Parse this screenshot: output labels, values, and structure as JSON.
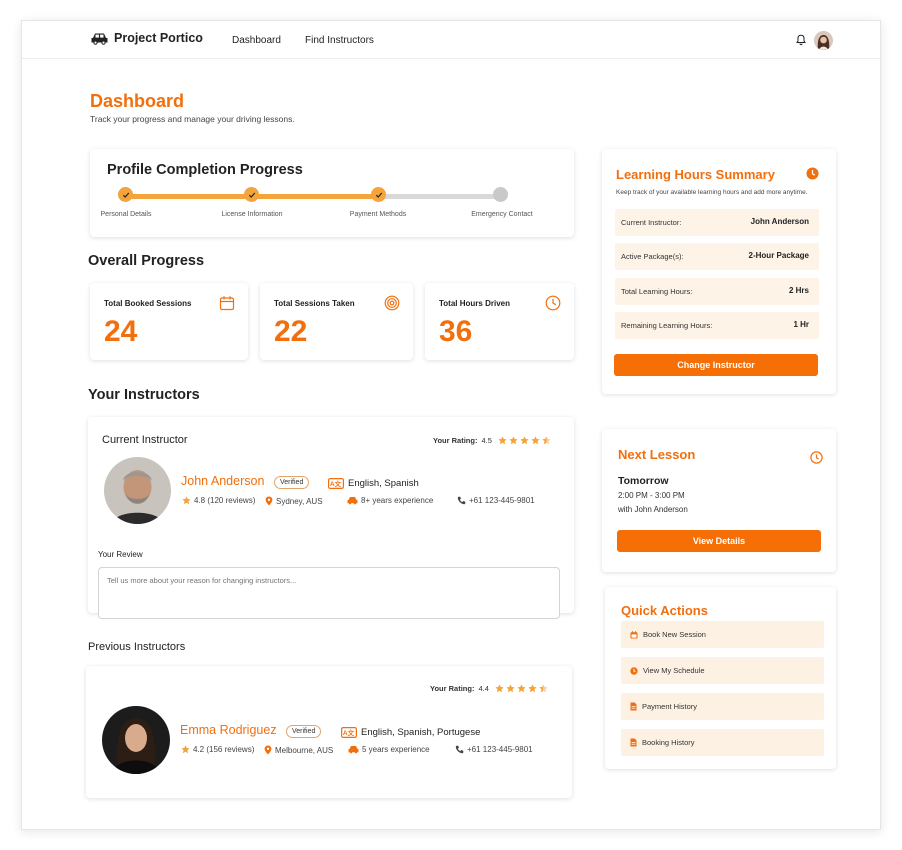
{
  "app": {
    "name": "Project Portico"
  },
  "nav": {
    "dashboard": "Dashboard",
    "find_instructors": "Find Instructors"
  },
  "page": {
    "title": "Dashboard",
    "subtitle": "Track your progress and manage your driving lessons."
  },
  "profile_progress": {
    "title": "Profile Completion Progress",
    "completed_steps": 3,
    "steps": [
      {
        "label": "Personal Details",
        "done": true
      },
      {
        "label": "License Information",
        "done": true
      },
      {
        "label": "Payment Methods",
        "done": true
      },
      {
        "label": "Emergency Contact",
        "done": false
      }
    ]
  },
  "overall": {
    "title": "Overall Progress",
    "stats": [
      {
        "label": "Total Booked Sessions",
        "value": "24",
        "icon": "calendar-icon"
      },
      {
        "label": "Total Sessions Taken",
        "value": "22",
        "icon": "target-icon"
      },
      {
        "label": "Total Hours Driven",
        "value": "36",
        "icon": "clock-icon"
      }
    ]
  },
  "instructors": {
    "title": "Your Instructors",
    "current": {
      "heading": "Current Instructor",
      "rating_label": "Your Rating:",
      "rating_value": "4.5",
      "stars": 4.5,
      "name": "John Anderson",
      "badge": "Verified",
      "reviews": "4.8 (120 reviews)",
      "location": "Sydney, AUS",
      "experience": "8+ years experience",
      "languages": "English, Spanish",
      "phone": "+61 123-445-9801",
      "review_label": "Your Review",
      "review_placeholder": "Tell us more about your reason for changing instructors..."
    },
    "previous_title": "Previous Instructors",
    "previous": [
      {
        "rating_label": "Your Rating:",
        "rating_value": "4.4",
        "stars": 4.4,
        "name": "Emma Rodriguez",
        "badge": "Verified",
        "reviews": "4.2 (156 reviews)",
        "location": "Melbourne, AUS",
        "experience": "5 years experience",
        "languages": "English, Spanish, Portugese",
        "phone": "+61 123-445-9801"
      }
    ]
  },
  "learning_hours": {
    "title": "Learning Hours Summary",
    "subtitle": "Keep track of your available learning hours and add more anytime.",
    "rows": [
      {
        "label": "Current Instructor:",
        "value": "John Anderson"
      },
      {
        "label": "Active Package(s):",
        "value": "2-Hour Package"
      },
      {
        "label": "Total Learning Hours:",
        "value": "2 Hrs"
      },
      {
        "label": "Remaining Learning Hours:",
        "value": "1 Hr"
      }
    ],
    "button": "Change Instructor"
  },
  "next_lesson": {
    "title": "Next Lesson",
    "day": "Tomorrow",
    "time": "2:00 PM - 3:00 PM",
    "with": "with John Anderson",
    "button": "View Details"
  },
  "quick_actions": {
    "title": "Quick Actions",
    "items": [
      {
        "label": "Book New Session",
        "icon": "calendar-icon"
      },
      {
        "label": "View My Schedule",
        "icon": "clock-icon"
      },
      {
        "label": "Payment History",
        "icon": "document-icon"
      },
      {
        "label": "Booking History",
        "icon": "document-icon"
      }
    ]
  },
  "colors": {
    "accent": "#f26f0d",
    "button": "#f66e06",
    "progress": "#f4a43a",
    "row_bg": "#fdf3e6",
    "star": "#f4a43a"
  }
}
